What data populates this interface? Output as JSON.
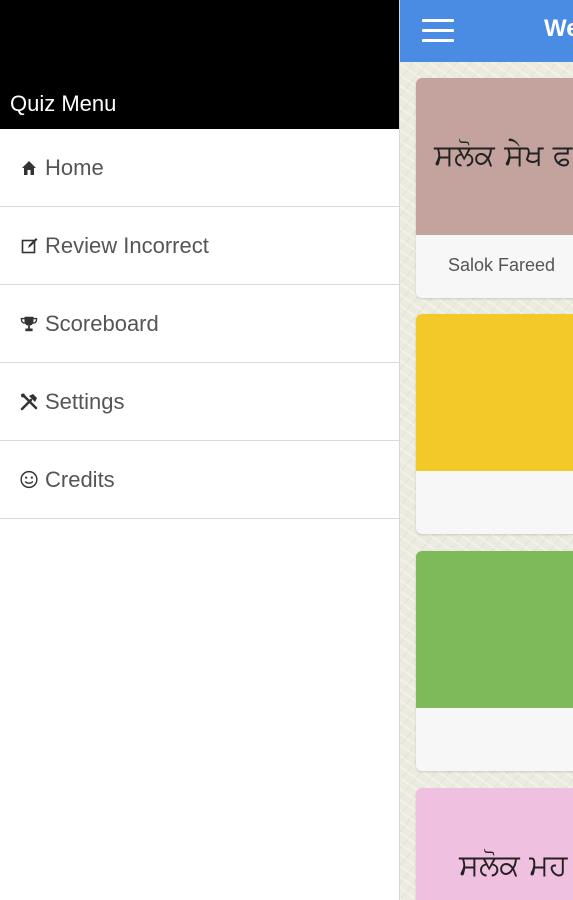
{
  "drawer": {
    "title": "Quiz Menu",
    "items": [
      {
        "label": "Home",
        "icon": "home-icon"
      },
      {
        "label": "Review Incorrect",
        "icon": "edit-icon"
      },
      {
        "label": "Scoreboard",
        "icon": "trophy-icon"
      },
      {
        "label": "Settings",
        "icon": "tools-icon"
      },
      {
        "label": "Credits",
        "icon": "smiley-icon"
      }
    ]
  },
  "topbar": {
    "title": "We",
    "menu_icon": "hamburger-icon",
    "color": "#4a8ce4"
  },
  "cards": [
    {
      "image_text": "ਸਲੋਕ ਸੇਖ ਫ",
      "caption": "Salok Fareed",
      "color": "#c4a29e"
    },
    {
      "image_text": "",
      "caption": "",
      "color": "#f2c928"
    },
    {
      "image_text": "",
      "caption": "",
      "color": "#7eb95a"
    },
    {
      "image_text": "ਸਲੋਕ ਮਹ",
      "caption": "",
      "color": "#f0c0e0"
    }
  ]
}
